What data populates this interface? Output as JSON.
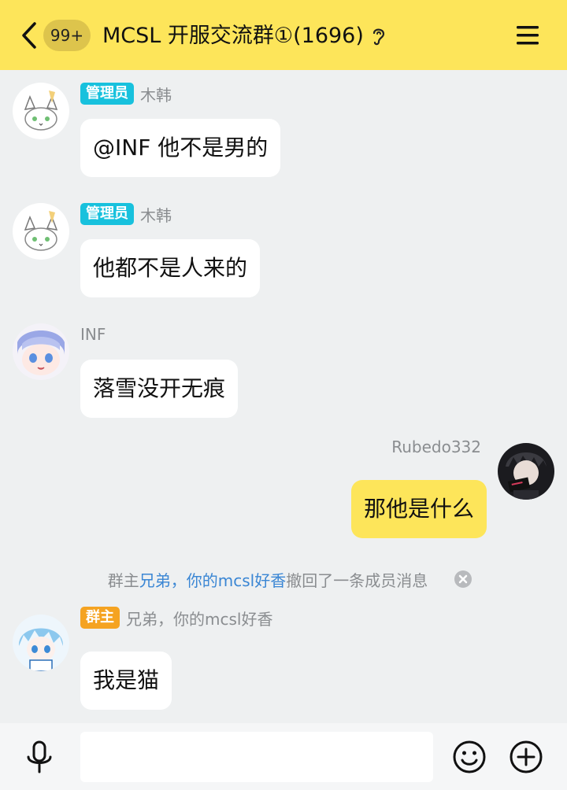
{
  "header": {
    "unread_badge": "99+",
    "title": "MCSL 开服交流群①(1696)",
    "icons": {
      "back": "chevron-left-icon",
      "listen": "ear-icon",
      "menu": "hamburger-menu-icon"
    }
  },
  "messages": [
    {
      "sender": "木韩",
      "role": "管理员",
      "text": "@INF 他不是男的"
    },
    {
      "sender": "木韩",
      "role": "管理员",
      "text": "他都不是人来的"
    },
    {
      "sender": "INF",
      "role": "",
      "text": "落雪没开无痕"
    },
    {
      "sender": "Rubedo332",
      "role": "",
      "text": "那他是什么",
      "mine": true
    },
    {
      "sender": "兄弟，你的mcsl好香",
      "role": "群主",
      "text": "我是猫"
    }
  ],
  "system_note": {
    "prefix": "群主",
    "name": "兄弟，你的mcsl好香",
    "suffix": "撤回了一条成员消息"
  },
  "bottom_bar": {
    "input_placeholder": "",
    "icons": {
      "voice": "microphone-icon",
      "emoji": "emoji-icon",
      "more": "plus-circle-icon"
    }
  },
  "colors": {
    "header_bg": "#fde55a",
    "admin_badge": "#18c1dd",
    "owner_badge": "#f5a321",
    "link": "#3a86d4",
    "chat_bg": "#eef0f1"
  }
}
